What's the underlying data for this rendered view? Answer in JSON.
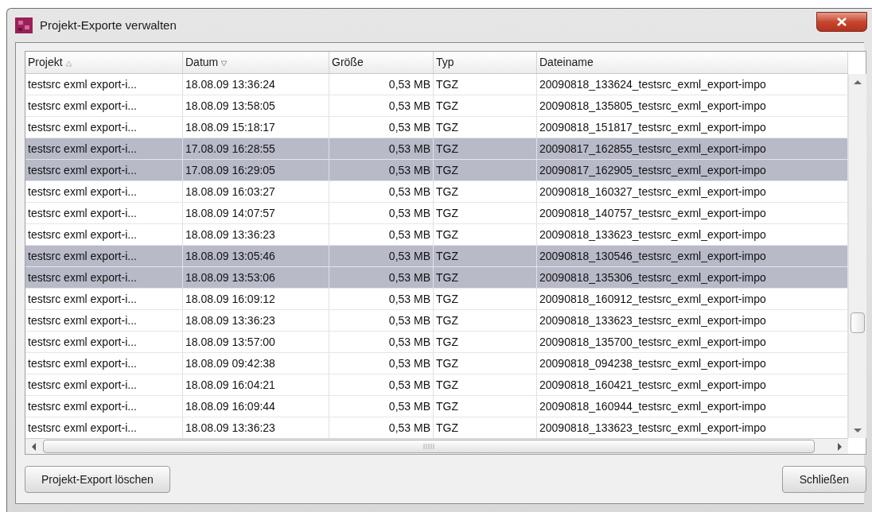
{
  "window": {
    "title": "Projekt-Exporte verwalten"
  },
  "table": {
    "columns": [
      {
        "label": "Projekt",
        "sorted_ascending": true,
        "sorted_descending": false
      },
      {
        "label": "Datum",
        "sorted_ascending": false,
        "sorted_descending": true
      },
      {
        "label": "Größe",
        "sorted_ascending": false,
        "sorted_descending": false
      },
      {
        "label": "Typ",
        "sorted_ascending": false,
        "sorted_descending": false
      },
      {
        "label": "Dateiname",
        "sorted_ascending": false,
        "sorted_descending": false
      }
    ],
    "rows": [
      {
        "selected": false,
        "cells": [
          "testsrc exml export-i...",
          "18.08.09 13:36:24",
          "0,53 MB",
          "TGZ",
          "20090818_133624_testsrc_exml_export-impo"
        ]
      },
      {
        "selected": false,
        "cells": [
          "testsrc exml export-i...",
          "18.08.09 13:58:05",
          "0,53 MB",
          "TGZ",
          "20090818_135805_testsrc_exml_export-impo"
        ]
      },
      {
        "selected": false,
        "cells": [
          "testsrc exml export-i...",
          "18.08.09 15:18:17",
          "0,53 MB",
          "TGZ",
          "20090818_151817_testsrc_exml_export-impo"
        ]
      },
      {
        "selected": true,
        "cells": [
          "testsrc exml export-i...",
          "17.08.09 16:28:55",
          "0,53 MB",
          "TGZ",
          "20090817_162855_testsrc_exml_export-impo"
        ]
      },
      {
        "selected": true,
        "cells": [
          "testsrc exml export-i...",
          "17.08.09 16:29:05",
          "0,53 MB",
          "TGZ",
          "20090817_162905_testsrc_exml_export-impo"
        ]
      },
      {
        "selected": false,
        "cells": [
          "testsrc exml export-i...",
          "18.08.09 16:03:27",
          "0,53 MB",
          "TGZ",
          "20090818_160327_testsrc_exml_export-impo"
        ]
      },
      {
        "selected": false,
        "cells": [
          "testsrc exml export-i...",
          "18.08.09 14:07:57",
          "0,53 MB",
          "TGZ",
          "20090818_140757_testsrc_exml_export-impo"
        ]
      },
      {
        "selected": false,
        "cells": [
          "testsrc exml export-i...",
          "18.08.09 13:36:23",
          "0,53 MB",
          "TGZ",
          "20090818_133623_testsrc_exml_export-impo"
        ]
      },
      {
        "selected": true,
        "cells": [
          "testsrc exml export-i...",
          "18.08.09 13:05:46",
          "0,53 MB",
          "TGZ",
          "20090818_130546_testsrc_exml_export-impo"
        ]
      },
      {
        "selected": true,
        "cells": [
          "testsrc exml export-i...",
          "18.08.09 13:53:06",
          "0,53 MB",
          "TGZ",
          "20090818_135306_testsrc_exml_export-impo"
        ]
      },
      {
        "selected": false,
        "cells": [
          "testsrc exml export-i...",
          "18.08.09 16:09:12",
          "0,53 MB",
          "TGZ",
          "20090818_160912_testsrc_exml_export-impo"
        ]
      },
      {
        "selected": false,
        "cells": [
          "testsrc exml export-i...",
          "18.08.09 13:36:23",
          "0,53 MB",
          "TGZ",
          "20090818_133623_testsrc_exml_export-impo"
        ]
      },
      {
        "selected": false,
        "cells": [
          "testsrc exml export-i...",
          "18.08.09 13:57:00",
          "0,53 MB",
          "TGZ",
          "20090818_135700_testsrc_exml_export-impo"
        ]
      },
      {
        "selected": false,
        "cells": [
          "testsrc exml export-i...",
          "18.08.09 09:42:38",
          "0,53 MB",
          "TGZ",
          "20090818_094238_testsrc_exml_export-impo"
        ]
      },
      {
        "selected": false,
        "cells": [
          "testsrc exml export-i...",
          "18.08.09 16:04:21",
          "0,53 MB",
          "TGZ",
          "20090818_160421_testsrc_exml_export-impo"
        ]
      },
      {
        "selected": false,
        "cells": [
          "testsrc exml export-i...",
          "18.08.09 16:09:44",
          "0,53 MB",
          "TGZ",
          "20090818_160944_testsrc_exml_export-impo"
        ]
      },
      {
        "selected": false,
        "cells": [
          "testsrc exml export-i...",
          "18.08.09 13:36:23",
          "0,53 MB",
          "TGZ",
          "20090818_133623_testsrc_exml_export-impo"
        ]
      }
    ]
  },
  "buttons": [
    "Projekt-Export löschen",
    "Schließen"
  ]
}
